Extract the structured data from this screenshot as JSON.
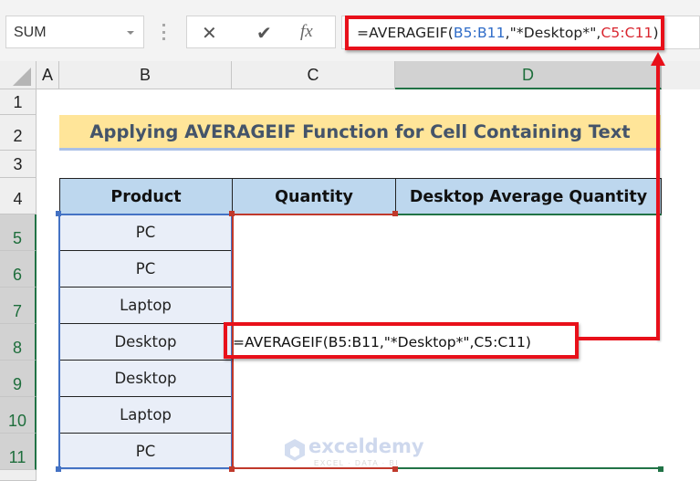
{
  "name_box": {
    "value": "SUM"
  },
  "formula_bar": {
    "cancel_icon": "✕",
    "enter_icon": "✔",
    "fx_label": "fx",
    "formula_parts": [
      {
        "text": "=AVERAGEIF(",
        "style": "plain"
      },
      {
        "text": "B5:B11",
        "style": "ref-blue"
      },
      {
        "text": ",\"*Desktop*\",",
        "style": "plain"
      },
      {
        "text": "C5:C11",
        "style": "ref-red"
      },
      {
        "text": ")",
        "style": "plain"
      }
    ],
    "formula": "=AVERAGEIF(B5:B11,\"*Desktop*\",C5:C11)"
  },
  "columns": [
    "A",
    "B",
    "C",
    "D"
  ],
  "rows": [
    "1",
    "2",
    "3",
    "4",
    "5",
    "6",
    "7",
    "8",
    "9",
    "10",
    "11"
  ],
  "title": "Applying AVERAGEIF Function for Cell Containing Text",
  "table": {
    "headers": [
      "Product",
      "Quantity",
      "Desktop Average Quantity"
    ],
    "products": [
      "PC",
      "PC",
      "Laptop",
      "Desktop",
      "Desktop",
      "Laptop",
      "PC"
    ]
  },
  "editing_cell": {
    "address": "C8",
    "text": "=AVERAGEIF(B5:B11,\"*Desktop*\",C5:C11)"
  },
  "watermark": {
    "name": "exceldemy",
    "tagline": "EXCEL · DATA · BI"
  },
  "colors": {
    "ref_blue": "#2f6cc8",
    "ref_red": "#d9262f",
    "callout_red": "#e8101a",
    "title_fill": "#ffe599",
    "header_fill": "#bdd7ee",
    "product_fill": "#e9eef8",
    "excel_green": "#217346"
  }
}
